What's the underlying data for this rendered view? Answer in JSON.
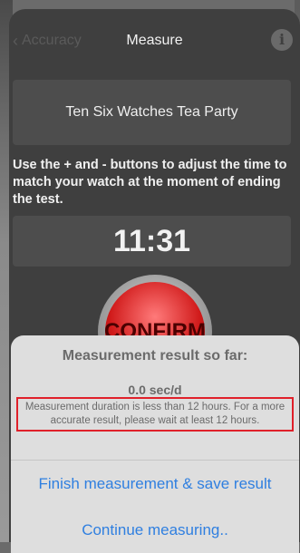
{
  "navbar": {
    "back_label": "Accuracy",
    "title": "Measure",
    "info_glyph": "i"
  },
  "watch": {
    "name": "Ten Six Watches Tea Party"
  },
  "instructions": "Use the + and - buttons to adjust the time to match your watch at the moment of ending the test.",
  "time": "11:31",
  "confirm_label": "CONFIRM",
  "alert": {
    "title": "Measurement result so far:",
    "value": "0.0 sec/d",
    "note": "Measurement duration is less than 12 hours. For a more accurate result, please wait at least 12 hours."
  },
  "actions": {
    "finish_label": "Finish measurement & save result",
    "continue_label": "Continue measuring.."
  },
  "colors": {
    "accent_blue": "#2f7fe0",
    "highlight_red": "#e0202a",
    "confirm_red": "#d01a1a"
  },
  "icons": {
    "back": "chevron-left-icon",
    "info": "info-icon"
  }
}
